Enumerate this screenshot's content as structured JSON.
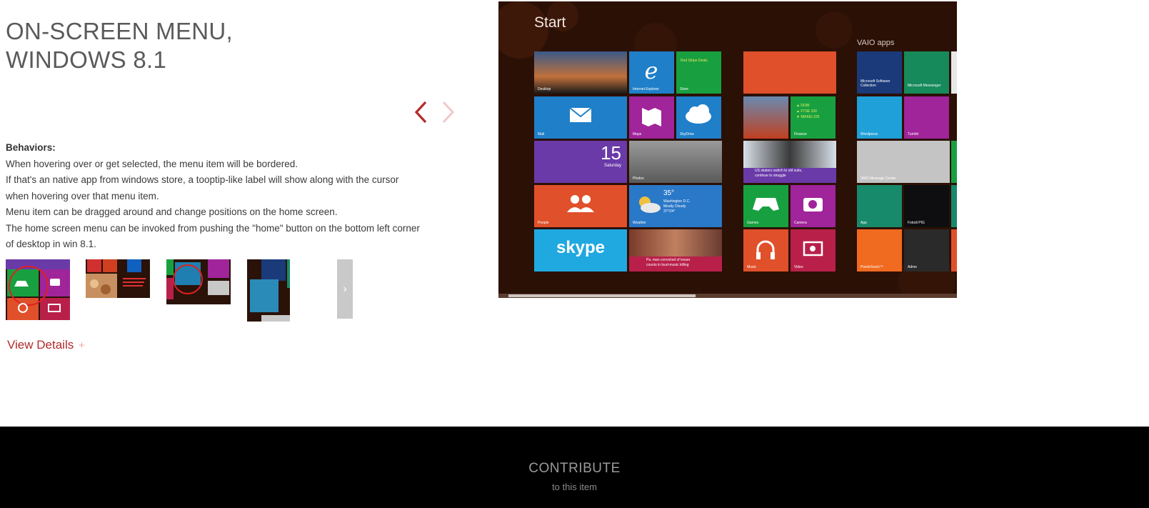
{
  "project": {
    "title_line1": "ON-SCREEN MENU,",
    "title_line2": "WINDOWS 8.1"
  },
  "behaviors": {
    "heading": "Behaviors:",
    "lines": [
      "When hovering over or get selected, the menu item will be bordered.",
      "If that's an native app from windows store, a tooptip-like label will show along with the cursor",
      "when hovering over that menu item.",
      "Menu item can be dragged around and change positions on the home screen.",
      "The home screen menu can be invoked from pushing the \"home\" button on the bottom left corner",
      "of desktop in win 8.1."
    ]
  },
  "view_details": {
    "label": "View Details",
    "plus": "+"
  },
  "carousel": {
    "prev_icon": "chevron-left-icon",
    "next_icon": "chevron-right-icon",
    "thumbs_next_glyph": "›"
  },
  "screenshot": {
    "start_label": "Start",
    "group_label": "VAIO apps",
    "calendar_date": "15",
    "calendar_day": "Saturday",
    "weather_temp": "35°",
    "weather_city": "Washington D.C.",
    "weather_cond": "Mostly Cloudy",
    "weather_range": "37°/24°",
    "skype_label": "skype",
    "tiles": {
      "desktop": "Desktop",
      "ie": "Internet Explorer",
      "store": "Store",
      "store_note": "Red Stripe Deals",
      "mail": "Mail",
      "maps": "Maps",
      "skydrive": "SkyDrive",
      "people": "People",
      "weather": "Weather",
      "photos": "Photos",
      "games": "Games",
      "camera": "Camera",
      "music": "Music",
      "video": "Video",
      "finance": "Finance",
      "news_line1": "US skaters switch to old suits,",
      "news_line2": "continue to struggle",
      "news2_line1": "Pa. man convicted of lesser",
      "news2_line2": "counts in loud-music killing",
      "vaio1": "Microsoft Software Collection",
      "vaio2": "Microsoft Messenger",
      "vaio3": "Wordpress",
      "vaio4": "Tumblr",
      "vaio5": "VAIO Message Center",
      "vaio6": "App",
      "vaio7": "Fotodi PIG",
      "vaio8": "PixelaTouch™",
      "vaio9": "Adme"
    },
    "finance_lines": [
      "▲ DOW",
      "▲ FTSE 100",
      "▼ NIKKEI 225"
    ]
  },
  "footer": {
    "title": "CONTRIBUTE",
    "subtitle": "to this item"
  },
  "colors": {
    "accent": "#b22a2a",
    "footer_bg": "#000000",
    "screen_bg": "#2b1005"
  }
}
